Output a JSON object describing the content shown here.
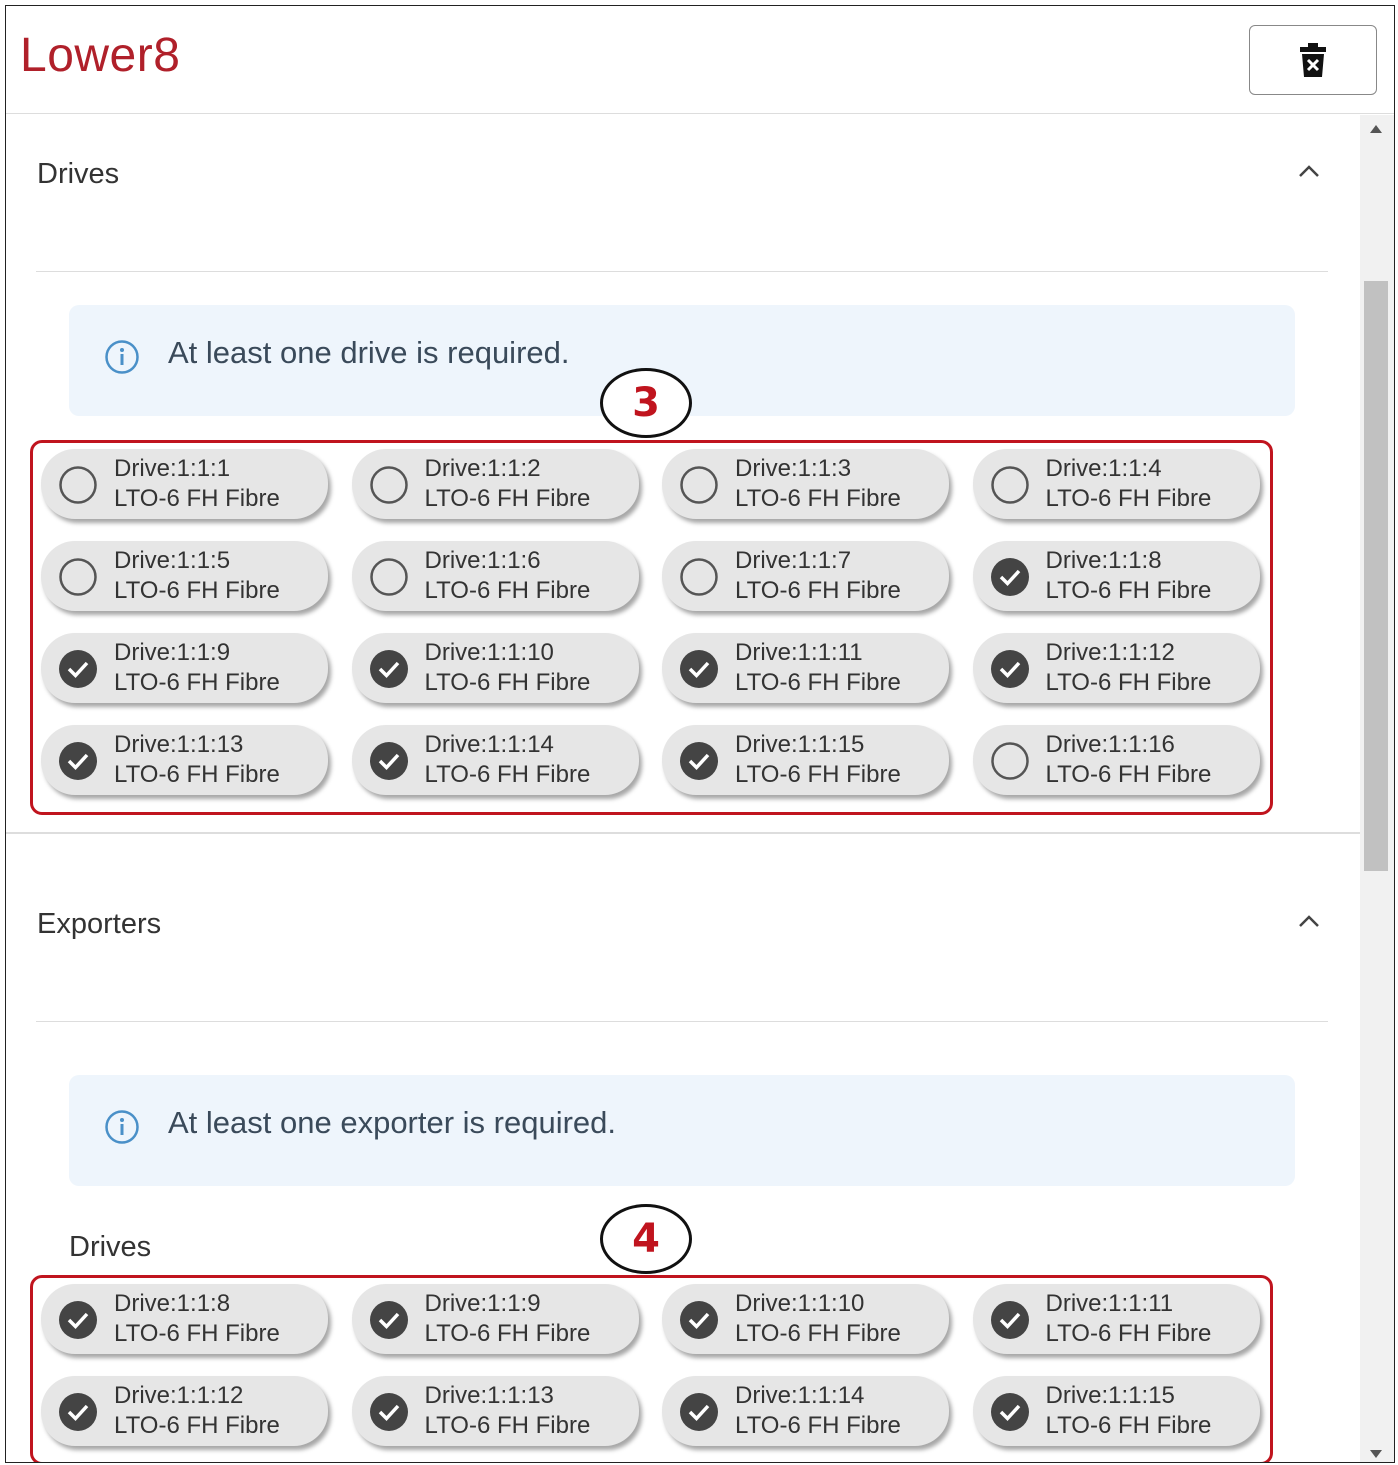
{
  "header": {
    "title": "Lower8",
    "delete_icon": "trash-x-icon"
  },
  "drives_section": {
    "title": "Drives",
    "info_text": "At least one drive is required.",
    "marker": "3",
    "drives": [
      {
        "name": "Drive:1:1:1",
        "type": "LTO-6 FH Fibre",
        "selected": false
      },
      {
        "name": "Drive:1:1:2",
        "type": "LTO-6 FH Fibre",
        "selected": false
      },
      {
        "name": "Drive:1:1:3",
        "type": "LTO-6 FH Fibre",
        "selected": false
      },
      {
        "name": "Drive:1:1:4",
        "type": "LTO-6 FH Fibre",
        "selected": false
      },
      {
        "name": "Drive:1:1:5",
        "type": "LTO-6 FH Fibre",
        "selected": false
      },
      {
        "name": "Drive:1:1:6",
        "type": "LTO-6 FH Fibre",
        "selected": false
      },
      {
        "name": "Drive:1:1:7",
        "type": "LTO-6 FH Fibre",
        "selected": false
      },
      {
        "name": "Drive:1:1:8",
        "type": "LTO-6 FH Fibre",
        "selected": true
      },
      {
        "name": "Drive:1:1:9",
        "type": "LTO-6 FH Fibre",
        "selected": true
      },
      {
        "name": "Drive:1:1:10",
        "type": "LTO-6 FH Fibre",
        "selected": true
      },
      {
        "name": "Drive:1:1:11",
        "type": "LTO-6 FH Fibre",
        "selected": true
      },
      {
        "name": "Drive:1:1:12",
        "type": "LTO-6 FH Fibre",
        "selected": true
      },
      {
        "name": "Drive:1:1:13",
        "type": "LTO-6 FH Fibre",
        "selected": true
      },
      {
        "name": "Drive:1:1:14",
        "type": "LTO-6 FH Fibre",
        "selected": true
      },
      {
        "name": "Drive:1:1:15",
        "type": "LTO-6 FH Fibre",
        "selected": true
      },
      {
        "name": "Drive:1:1:16",
        "type": "LTO-6 FH Fibre",
        "selected": false
      }
    ]
  },
  "exporters_section": {
    "title": "Exporters",
    "info_text": "At least one exporter is required.",
    "marker": "4",
    "sub_label": "Drives",
    "drives": [
      {
        "name": "Drive:1:1:8",
        "type": "LTO-6 FH Fibre",
        "selected": true
      },
      {
        "name": "Drive:1:1:9",
        "type": "LTO-6 FH Fibre",
        "selected": true
      },
      {
        "name": "Drive:1:1:10",
        "type": "LTO-6 FH Fibre",
        "selected": true
      },
      {
        "name": "Drive:1:1:11",
        "type": "LTO-6 FH Fibre",
        "selected": true
      },
      {
        "name": "Drive:1:1:12",
        "type": "LTO-6 FH Fibre",
        "selected": true
      },
      {
        "name": "Drive:1:1:13",
        "type": "LTO-6 FH Fibre",
        "selected": true
      },
      {
        "name": "Drive:1:1:14",
        "type": "LTO-6 FH Fibre",
        "selected": true
      },
      {
        "name": "Drive:1:1:15",
        "type": "LTO-6 FH Fibre",
        "selected": true
      }
    ]
  }
}
